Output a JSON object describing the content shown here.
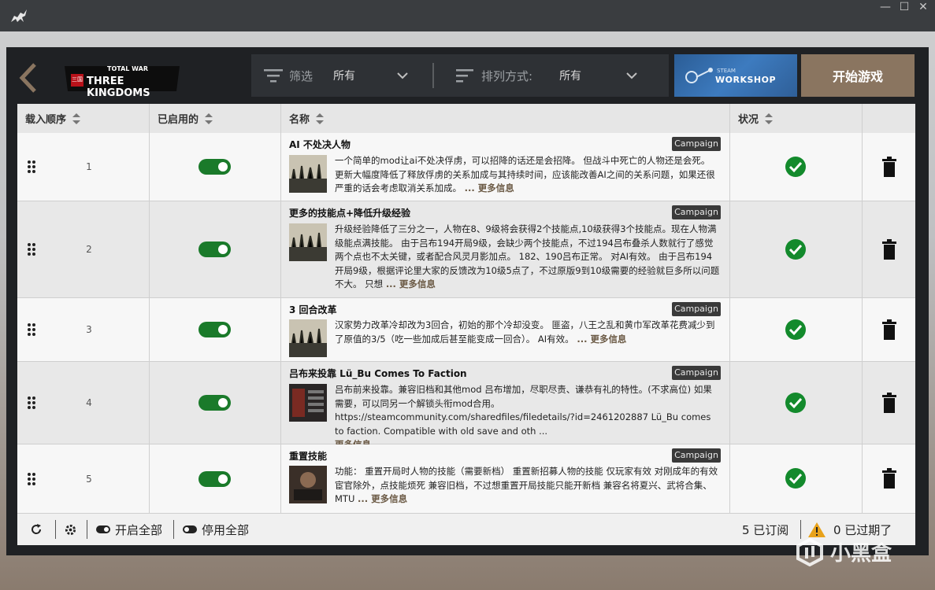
{
  "header": {
    "filter_label": "筛选",
    "filter_value": "所有",
    "sort_label": "排列方式:",
    "sort_value": "所有",
    "workshop_small": "STEAM",
    "workshop_label": "WORKSHOP",
    "start_label": "开始游戏",
    "logo_top": "TOTAL WAR",
    "logo_main": "THREE KINGDOMS",
    "logo_seal": "三国"
  },
  "columns": {
    "order": "载入顺序",
    "enabled": "已启用的",
    "name": "名称",
    "status": "状况"
  },
  "mods": [
    {
      "order": "1",
      "title": "AI 不处决人物",
      "badge": "Campaign",
      "desc": "一个简单的mod让ai不处决俘虏，可以招降的话还是会招降。 但战斗中死亡的人物还是会死。  更新大幅度降低了释放俘虏的关系加成与其持续时间，应该能改善AI之间的关系问题，如果还很严重的话会考虑取消关系加成。 ",
      "more": "... 更多信息"
    },
    {
      "order": "2",
      "title": "更多的技能点+降低升级经验",
      "badge": "Campaign",
      "desc": "升级经验降低了三分之一，人物在8、9级将会获得2个技能点,10级获得3个技能点。现在人物满级能点满技能。  由于吕布194开局9级，会缺少两个技能点，不过194吕布叠杀人数就行了感觉两个点也不太关键，或者配合风灵月影加点。 182、190吕布正常。 对AI有效。  由于吕布194开局9级，根据评论里大家的反馈改为10级5点了，不过原版9到10级需要的经验就巨多所以问题不大。  只想 ",
      "more": "... 更多信息"
    },
    {
      "order": "3",
      "title": "3 回合改革",
      "badge": "Campaign",
      "desc": "汉家势力改革冷却改为3回合，初始的那个冷却没变。 匪盗，八王之乱和黄巾军改革花费减少到了原值的3/5（吃一些加成后甚至能变成一回合）。 AI有效。 ",
      "more": "... 更多信息"
    },
    {
      "order": "4",
      "title": "吕布来投靠 Lü_Bu Comes To Faction",
      "badge": "Campaign",
      "desc": "吕布前来投靠。兼容旧档和其他mod 吕布增加，尽职尽责、谦恭有礼的特性。(不求高位) 如果需要，可以同另一个解锁头衔mod合用。 https://steamcommunity.com/sharedfiles/filedetails/?id=2461202887   Lü_Bu comes to faction. Compatible with old save and oth ...",
      "more": "更多信息"
    },
    {
      "order": "5",
      "title": "重置技能",
      "badge": "Campaign",
      "desc": "功能：  重置开局时人物的技能（需要新档） 重置新招募人物的技能  仅玩家有效 对刚成年的有效 宦官除外，点技能烦死  兼容旧档，不过想重置开局技能只能开新档 兼容名将夏兴、武将合集、MTU ",
      "more": "... 更多信息"
    }
  ],
  "footer": {
    "enable_all": "开启全部",
    "disable_all": "停用全部",
    "subscribed": "5 已订阅",
    "expired": "0 已过期了"
  },
  "watermark": {
    "text": "小黑盒"
  },
  "colors": {
    "toggle_on": "#1a7a2a",
    "status_ok": "#138a2c",
    "start_button": "#8a7560",
    "workshop": "#3d7bbf",
    "warning": "#e8a21a"
  }
}
